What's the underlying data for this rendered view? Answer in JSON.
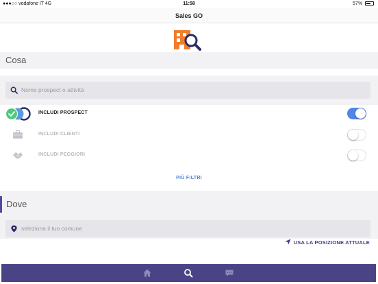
{
  "status_bar": {
    "carrier": "●●●○○ vodafone IT",
    "network": "4G",
    "time": "11:58",
    "battery": "57%"
  },
  "nav": {
    "title": "Sales GO"
  },
  "cosa": {
    "header": "Cosa",
    "search_placeholder": "Nome prospect o attività",
    "toggles": [
      {
        "label": "INCLUDI PROSPECT",
        "on": true,
        "icon": "prospect-badge-icon"
      },
      {
        "label": "INCLUDI CLIENTI",
        "on": false,
        "icon": "briefcase-icon"
      },
      {
        "label": "INCLUDI PEGGIORI",
        "on": false,
        "icon": "handshake-icon"
      }
    ],
    "more_filters": "PIÙ FILTRI"
  },
  "dove": {
    "header": "Dove",
    "comune_placeholder": "seleziona il tuo comune",
    "use_location": "USA LA POSIZIONE ATTUALE"
  },
  "tabs": [
    {
      "name": "home",
      "icon": "home-icon"
    },
    {
      "name": "search",
      "icon": "search-icon"
    },
    {
      "name": "messages",
      "icon": "chat-icon"
    }
  ],
  "colors": {
    "accent": "#4a4486",
    "toggle_on": "#4f86e6",
    "link": "#4f7fd4",
    "logo_orange": "#ef7d2b"
  }
}
